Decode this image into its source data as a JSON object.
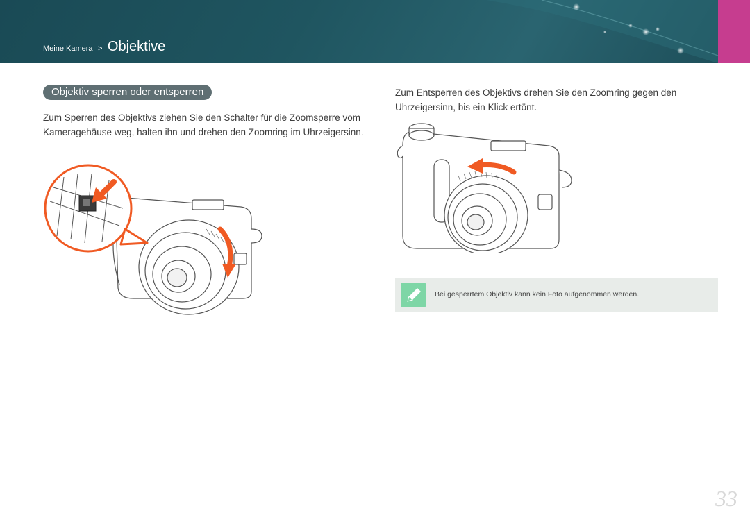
{
  "header": {
    "breadcrumb_parent": "Meine Kamera",
    "breadcrumb_separator": ">",
    "breadcrumb_current": "Objektive",
    "background_color": "#1f5560",
    "tab_color": "#c63d8f"
  },
  "section": {
    "title": "Objektiv sperren oder entsperren",
    "pill_color": "#5f6f73"
  },
  "left_column": {
    "text": "Zum Sperren des Objektivs ziehen Sie den Schalter für die Zoomsperre vom Kameragehäuse weg, halten ihn und drehen den Zoomring im Uhrzeigersinn."
  },
  "right_column": {
    "text": "Zum Entsperren des Objektivs drehen Sie den Zoomring gegen den Uhrzeigersinn, bis ein Klick ertönt."
  },
  "note": {
    "icon": "pencil-note-icon",
    "text": "Bei gesperrtem Objektiv kann kein Foto aufgenommen werden.",
    "icon_color": "#7ed6a6"
  },
  "accent_color": "#f05a23",
  "page_number": "33"
}
